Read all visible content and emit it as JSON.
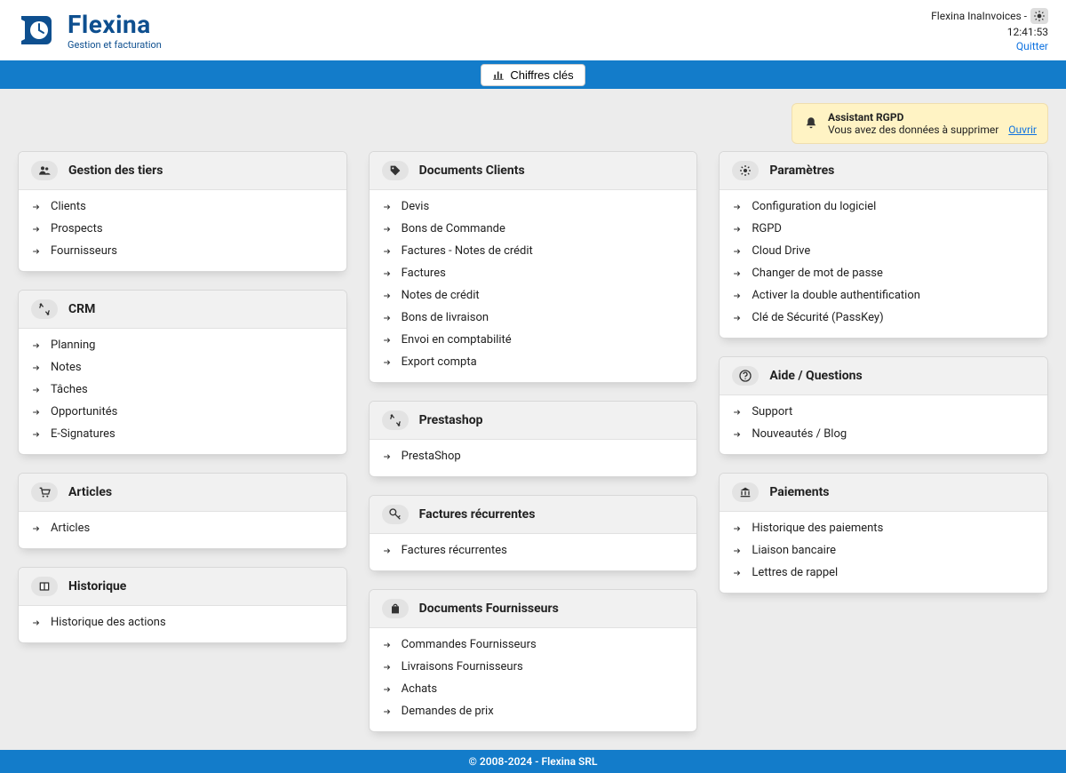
{
  "header": {
    "logo_name": "Flexina",
    "logo_tagline": "Gestion et facturation",
    "account": "Flexina InaInvoices -",
    "time": "12:41:53",
    "quit": "Quitter"
  },
  "kpi_button": "Chiffres clés",
  "notice": {
    "title": "Assistant RGPD",
    "text": "Vous avez des données à supprimer",
    "action": "Ouvrir"
  },
  "columns": [
    [
      {
        "icon": "group",
        "title": "Gestion des tiers",
        "items": [
          "Clients",
          "Prospects",
          "Fournisseurs"
        ]
      },
      {
        "icon": "crm",
        "title": "CRM",
        "items": [
          "Planning",
          "Notes",
          "Tâches",
          "Opportunités",
          "E-Signatures"
        ]
      },
      {
        "icon": "cart",
        "title": "Articles",
        "items": [
          "Articles"
        ]
      },
      {
        "icon": "book",
        "title": "Historique",
        "items": [
          "Historique des actions"
        ]
      }
    ],
    [
      {
        "icon": "tag",
        "title": "Documents Clients",
        "items": [
          "Devis",
          "Bons de Commande",
          "Factures - Notes de crédit",
          "Factures",
          "Notes de crédit",
          "Bons de livraison",
          "Envoi en comptabilité",
          "Export compta"
        ]
      },
      {
        "icon": "crm",
        "title": "Prestashop",
        "items": [
          "PrestaShop"
        ]
      },
      {
        "icon": "key",
        "title": "Factures récurrentes",
        "items": [
          "Factures récurrentes"
        ]
      },
      {
        "icon": "bag",
        "title": "Documents Fournisseurs",
        "items": [
          "Commandes Fournisseurs",
          "Livraisons Fournisseurs",
          "Achats",
          "Demandes de prix"
        ]
      }
    ],
    [
      {
        "icon": "gear",
        "title": "Paramètres",
        "items": [
          "Configuration du logiciel",
          "RGPD",
          "Cloud Drive",
          "Changer de mot de passe",
          "Activer la double authentification",
          "Clé de Sécurité (PassKey)"
        ]
      },
      {
        "icon": "help",
        "title": "Aide / Questions",
        "items": [
          "Support",
          "Nouveautés / Blog"
        ]
      },
      {
        "icon": "bank",
        "title": "Paiements",
        "items": [
          "Historique des paiements",
          "Liaison bancaire",
          "Lettres de rappel"
        ]
      }
    ]
  ],
  "footer": "© 2008-2024 - Flexina SRL"
}
